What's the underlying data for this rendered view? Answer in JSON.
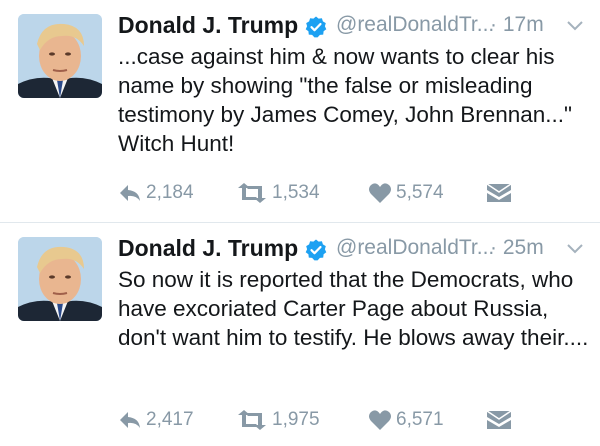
{
  "colors": {
    "name": "#14171a",
    "secondary": "#8899a6",
    "verified": "#1da1f2",
    "divider": "#e1e8ed"
  },
  "tweets": [
    {
      "display_name": "Donald J. Trump",
      "handle": "@realDonaldTr...",
      "separator": "·",
      "time": "17m",
      "text": "...case against him & now wants to clear his name by showing \"the false or misleading testimony by James Comey, John Brennan...\" Witch Hunt!",
      "replies": "2,184",
      "retweets": "1,534",
      "likes": "5,574",
      "icons": [
        "avatar",
        "verified-icon",
        "chevron-down-icon",
        "reply-icon",
        "retweet-icon",
        "heart-icon",
        "envelope-icon"
      ]
    },
    {
      "display_name": "Donald J. Trump",
      "handle": "@realDonaldTr...",
      "separator": "·",
      "time": "25m",
      "text": "So now it is reported that the Democrats, who have excoriated Carter Page about Russia, don't want him to testify. He blows away their....",
      "replies": "2,417",
      "retweets": "1,975",
      "likes": "6,571",
      "icons": [
        "avatar",
        "verified-icon",
        "chevron-down-icon",
        "reply-icon",
        "retweet-icon",
        "heart-icon",
        "envelope-icon"
      ]
    }
  ]
}
